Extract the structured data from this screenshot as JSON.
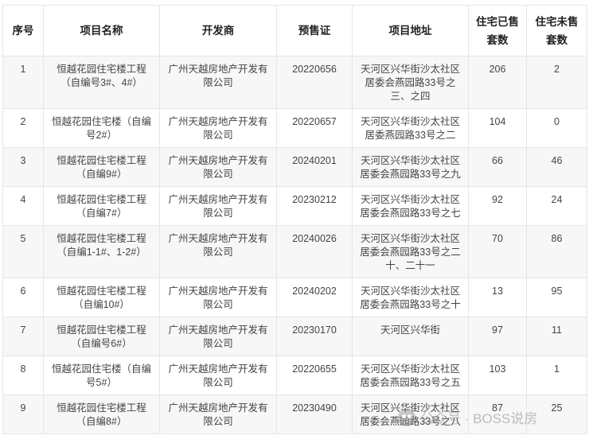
{
  "table": {
    "headers": [
      "序号",
      "项目名称",
      "开发商",
      "预售证",
      "项目地址",
      "住宅已售套数",
      "住宅未售套数"
    ],
    "rows": [
      {
        "no": "1",
        "name": "恒越花园住宅楼工程（自编号3#、4#）",
        "developer": "广州天越房地产开发有限公司",
        "permit": "20220656",
        "address": "天河区兴华街沙太社区居委会燕园路33号之三、之四",
        "sold": "206",
        "unsold": "2"
      },
      {
        "no": "2",
        "name": "恒越花园住宅楼（自编号2#）",
        "developer": "广州天越房地产开发有限公司",
        "permit": "20220657",
        "address": "天河区兴华街沙太社区居委燕园路33号之二",
        "sold": "104",
        "unsold": "0"
      },
      {
        "no": "3",
        "name": "恒越花园住宅楼工程（自编9#）",
        "developer": "广州天越房地产开发有限公司",
        "permit": "20240201",
        "address": "天河区兴华街沙太社区居委会燕园路33号之九",
        "sold": "66",
        "unsold": "46"
      },
      {
        "no": "4",
        "name": "恒越花园住宅楼工程（自编7#）",
        "developer": "广州天越房地产开发有限公司",
        "permit": "20230212",
        "address": "天河区兴华街沙太社区居委会燕园路33号之七",
        "sold": "92",
        "unsold": "24"
      },
      {
        "no": "5",
        "name": "恒越花园住宅楼工程（自编1-1#、1-2#）",
        "developer": "广州天越房地产开发有限公司",
        "permit": "20240026",
        "address": "天河区兴华街沙太社区居委会燕园路33号之二十、二十一",
        "sold": "70",
        "unsold": "86"
      },
      {
        "no": "6",
        "name": "恒越花园住宅楼工程（自编10#）",
        "developer": "广州天越房地产开发有限公司",
        "permit": "20240202",
        "address": "天河区兴华街沙太社区居委会燕园路33号之十",
        "sold": "13",
        "unsold": "95"
      },
      {
        "no": "7",
        "name": "恒越花园住宅楼工程（自编号6#）",
        "developer": "广州天越房地产开发有限公司",
        "permit": "20230170",
        "address": "天河区兴华街",
        "sold": "97",
        "unsold": "11"
      },
      {
        "no": "8",
        "name": "恒越花园住宅楼（自编号5#）",
        "developer": "广州天越房地产开发有限公司",
        "permit": "20220655",
        "address": "天河区兴华街沙太社区居委会燕园路33号之五",
        "sold": "103",
        "unsold": "1"
      },
      {
        "no": "9",
        "name": "恒越花园住宅楼工程（自编8#）",
        "developer": "广州天越房地产开发有限公司",
        "permit": "20230490",
        "address": "天河区兴华街沙太社区居委会燕园路33号之八",
        "sold": "87",
        "unsold": "25"
      }
    ]
  },
  "watermark": {
    "text": "公众号 · BOSS说房",
    "icon": "wechat-icon"
  }
}
